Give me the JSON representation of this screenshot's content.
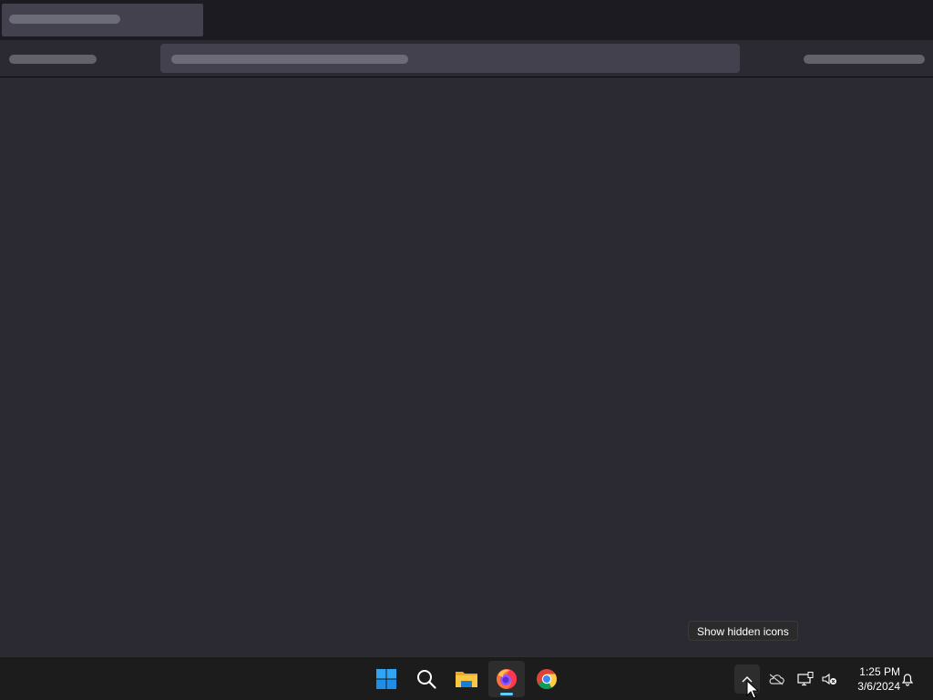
{
  "tray": {
    "tooltip": "Show hidden icons",
    "chevron_icon": "chevron-up-icon",
    "onedrive_icon": "cloud-offline-icon",
    "network_icon": "network-disconnected-icon",
    "volume_icon": "volume-muted-icon",
    "notification_icon": "bell-icon"
  },
  "clock": {
    "time": "1:25 PM",
    "date": "3/6/2024"
  },
  "taskbar": {
    "pinned": [
      {
        "name": "start",
        "icon": "windows-logo-icon"
      },
      {
        "name": "search",
        "icon": "search-icon"
      },
      {
        "name": "file-explorer",
        "icon": "folder-icon"
      },
      {
        "name": "firefox",
        "icon": "firefox-icon",
        "active": true
      },
      {
        "name": "chrome",
        "icon": "chrome-icon"
      }
    ],
    "accent": "#60cdff"
  },
  "colors": {
    "browser_bg": "#2b2a33",
    "tabstrip_bg": "#1c1b22",
    "taskbar_bg": "#1c1c1c"
  }
}
